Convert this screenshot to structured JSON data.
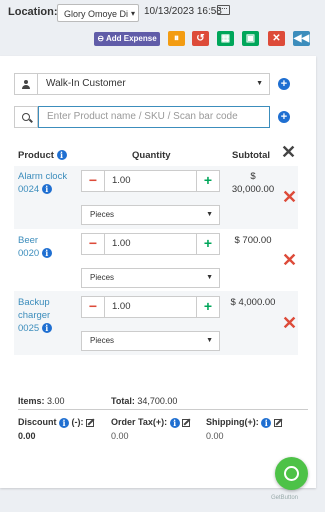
{
  "header": {
    "location_label": "Location:",
    "location_value": "Glory Omoye Di",
    "datetime": "10/13/2023 16:58",
    "add_expense_label": "Add Expense"
  },
  "customer": {
    "selected": "Walk-In Customer"
  },
  "search": {
    "placeholder": "Enter Product name / SKU / Scan bar code"
  },
  "table": {
    "col_product": "Product",
    "col_quantity": "Quantity",
    "col_subtotal": "Subtotal",
    "rows": [
      {
        "name_line1": "Alarm clock",
        "name_line2": "0024",
        "qty": "1.00",
        "unit": "Pieces",
        "subtotal_line1": "$",
        "subtotal_line2": "30,000.00"
      },
      {
        "name_line1": "Beer",
        "name_line2": "0020",
        "qty": "1.00",
        "unit": "Pieces",
        "subtotal_line1": "$ 700.00",
        "subtotal_line2": ""
      },
      {
        "name_line1": "Backup",
        "name_line2": "charger",
        "name_line3": "0025",
        "qty": "1.00",
        "unit": "Pieces",
        "subtotal_line1": "$ 4,000.00",
        "subtotal_line2": ""
      }
    ]
  },
  "totals": {
    "items_label": "Items:",
    "items_value": "3.00",
    "total_label": "Total:",
    "total_value": "34,700.00",
    "discount_label": "Discount",
    "discount_suffix": "(-):",
    "discount_value": "0.00",
    "order_tax_label": "Order Tax(+):",
    "order_tax_value": "0.00",
    "shipping_label": "Shipping(+):",
    "shipping_value": "0.00"
  },
  "footer": {
    "getbutton": "GetButton"
  },
  "colors": {
    "primary": "#1f6fd1",
    "danger": "#dd4b39",
    "success": "#00a65a",
    "purple": "#605ca8",
    "whatsapp": "#4dc247"
  }
}
